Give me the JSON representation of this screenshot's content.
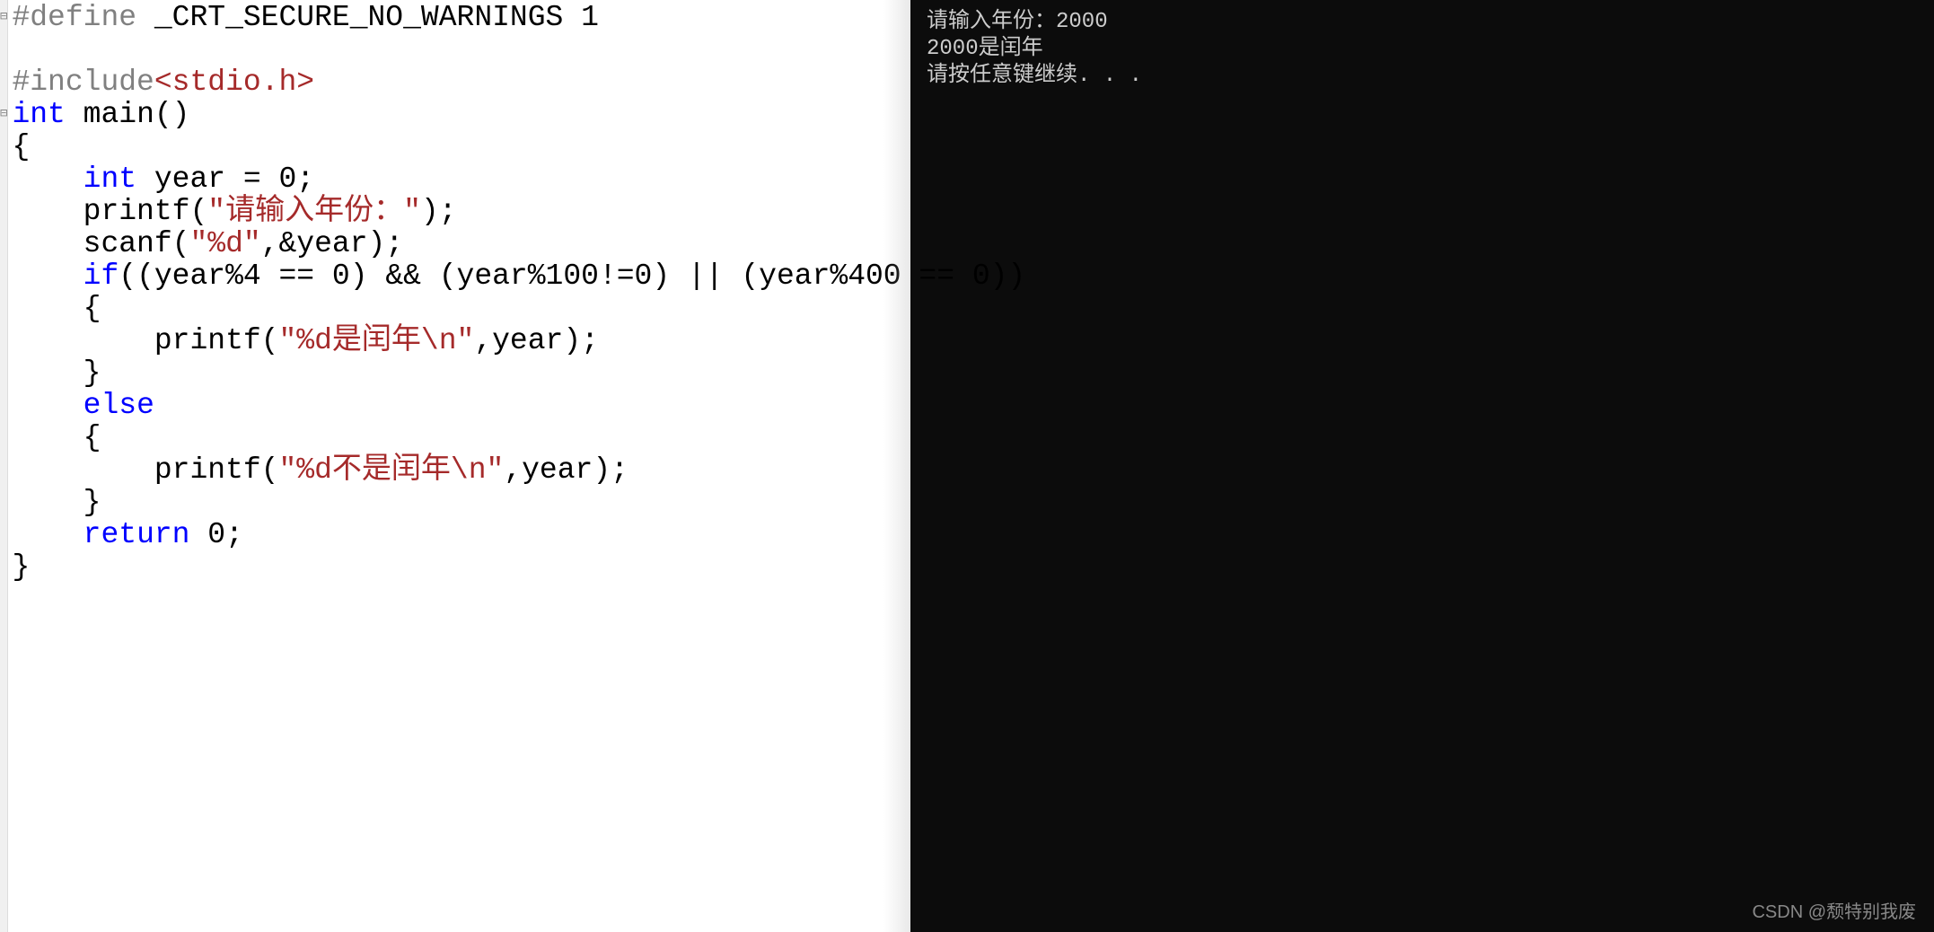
{
  "code": {
    "lines": [
      {
        "fold": "⊟",
        "segments": [
          {
            "cls": "keyword-purple",
            "text": "#define"
          },
          {
            "cls": "normal",
            "text": " _CRT_SECURE_NO_WARNINGS 1"
          }
        ]
      },
      {
        "fold": "",
        "segments": [
          {
            "cls": "normal",
            "text": ""
          }
        ]
      },
      {
        "fold": "",
        "segments": [
          {
            "cls": "keyword-purple",
            "text": "#include"
          },
          {
            "cls": "angle-bracket",
            "text": "<stdio.h>"
          }
        ]
      },
      {
        "fold": "⊟",
        "segments": [
          {
            "cls": "keyword-blue",
            "text": "int"
          },
          {
            "cls": "normal",
            "text": " main()"
          }
        ]
      },
      {
        "fold": "",
        "segments": [
          {
            "cls": "normal",
            "text": "{"
          }
        ]
      },
      {
        "fold": "",
        "segments": [
          {
            "cls": "normal",
            "text": "    "
          },
          {
            "cls": "keyword-blue",
            "text": "int"
          },
          {
            "cls": "normal",
            "text": " year = 0;"
          }
        ]
      },
      {
        "fold": "",
        "segments": [
          {
            "cls": "normal",
            "text": "    printf("
          },
          {
            "cls": "string",
            "text": "\"请输入年份：\""
          },
          {
            "cls": "normal",
            "text": ");"
          }
        ]
      },
      {
        "fold": "",
        "segments": [
          {
            "cls": "normal",
            "text": "    scanf("
          },
          {
            "cls": "string",
            "text": "\"%d\""
          },
          {
            "cls": "normal",
            "text": ",&year);"
          }
        ]
      },
      {
        "fold": "",
        "segments": [
          {
            "cls": "normal",
            "text": "    "
          },
          {
            "cls": "keyword-blue",
            "text": "if"
          },
          {
            "cls": "normal",
            "text": "((year%4 == 0) && (year%100!=0) || (year%400 == 0))"
          }
        ]
      },
      {
        "fold": "",
        "segments": [
          {
            "cls": "normal",
            "text": "    {"
          }
        ]
      },
      {
        "fold": "",
        "segments": [
          {
            "cls": "normal",
            "text": "        printf("
          },
          {
            "cls": "string",
            "text": "\"%d是闰年\\n\""
          },
          {
            "cls": "normal",
            "text": ",year);"
          }
        ]
      },
      {
        "fold": "",
        "segments": [
          {
            "cls": "normal",
            "text": "    }"
          }
        ]
      },
      {
        "fold": "",
        "segments": [
          {
            "cls": "normal",
            "text": "    "
          },
          {
            "cls": "keyword-blue",
            "text": "else"
          }
        ]
      },
      {
        "fold": "",
        "segments": [
          {
            "cls": "normal",
            "text": "    {"
          }
        ]
      },
      {
        "fold": "",
        "segments": [
          {
            "cls": "normal",
            "text": "        printf("
          },
          {
            "cls": "string",
            "text": "\"%d不是闰年\\n\""
          },
          {
            "cls": "normal",
            "text": ",year);"
          }
        ]
      },
      {
        "fold": "",
        "segments": [
          {
            "cls": "normal",
            "text": "    }"
          }
        ]
      },
      {
        "fold": "",
        "segments": [
          {
            "cls": "normal",
            "text": "    "
          },
          {
            "cls": "keyword-blue",
            "text": "return"
          },
          {
            "cls": "normal",
            "text": " 0;"
          }
        ]
      },
      {
        "fold": "",
        "segments": [
          {
            "cls": "normal",
            "text": "}"
          }
        ]
      }
    ]
  },
  "console": {
    "lines": [
      "请输入年份：2000",
      "2000是闰年",
      "请按任意键继续. . ."
    ]
  },
  "watermark": "CSDN @颓特别我废"
}
